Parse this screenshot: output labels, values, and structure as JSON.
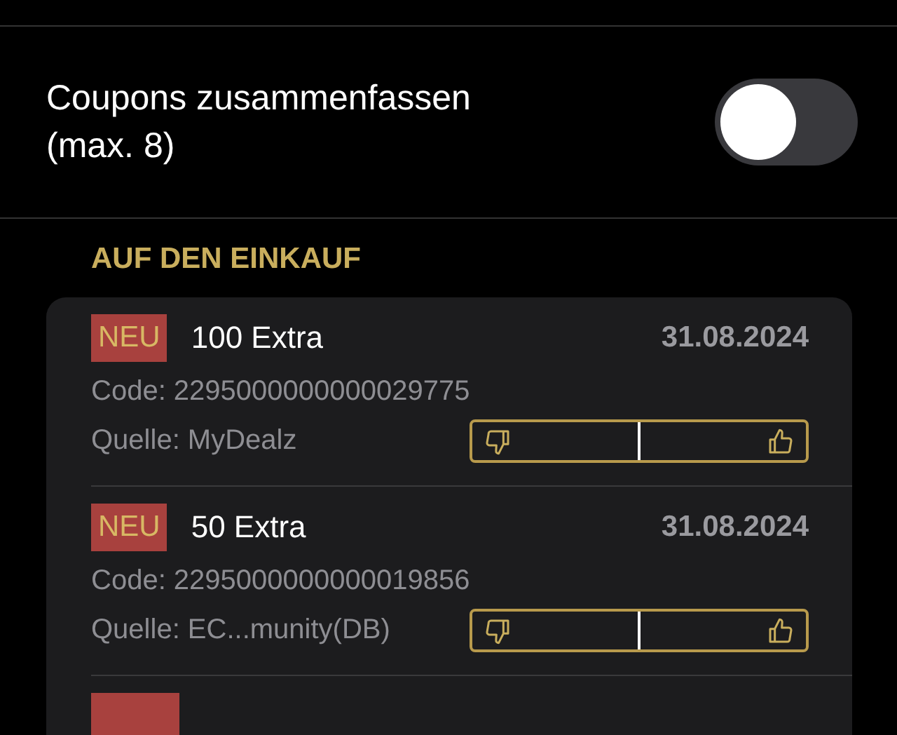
{
  "settings": {
    "label": "Coupons zusammenfassen",
    "sublabel": "(max. 8)",
    "on": false
  },
  "section": {
    "title": "AUF DEN EINKAUF"
  },
  "coupons": [
    {
      "kind": "full",
      "badge": "NEU",
      "title": "100 Extra",
      "date": "31.08.2024",
      "code": "Code: 2295000000000029775",
      "source": "Quelle: MyDealz"
    },
    {
      "kind": "full",
      "badge": "NEU",
      "title": "50 Extra",
      "date": "31.08.2024",
      "code": "Code: 2295000000000019856",
      "source": "Quelle: EC...munity(DB)"
    },
    {
      "kind": "cut"
    }
  ]
}
